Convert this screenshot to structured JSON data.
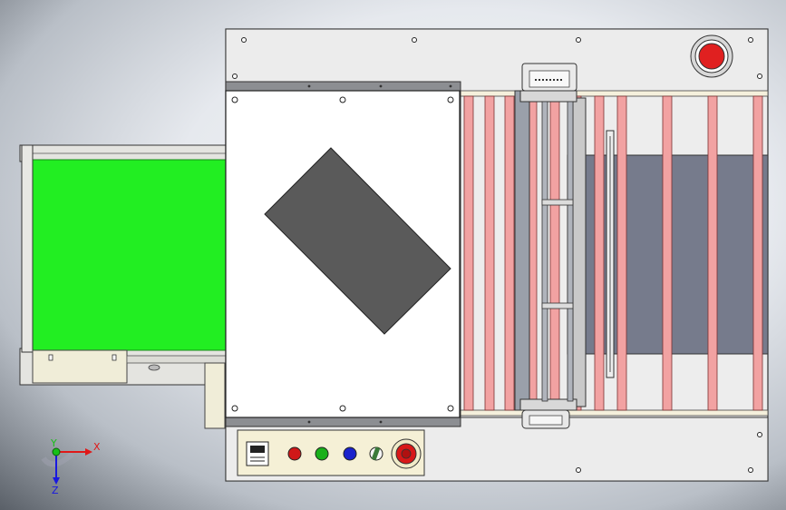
{
  "viewport": {
    "kind": "cad-3d-viewport",
    "background": "gradient-light-gray"
  },
  "model": {
    "description_parts": [
      "left-belt-conveyor",
      "shrink-tunnel-cover",
      "roller-conveyor",
      "sealing-frame",
      "control-panel",
      "emergency-stop"
    ],
    "colors": {
      "belt": "#22ee22",
      "frame": "#ededed",
      "cover": "#ffffff",
      "product": "#5a5a5a",
      "rollers": "#f2a2a2",
      "roller_bed": "#767b8c",
      "estop": "#e02020"
    },
    "control_panel": {
      "buttons": [
        {
          "name": "red-button",
          "color": "#d01818"
        },
        {
          "name": "green-button",
          "color": "#1ab01a"
        },
        {
          "name": "blue-button",
          "color": "#1a22cc"
        },
        {
          "name": "selector-switch",
          "color": "#4a8a4a"
        }
      ]
    }
  },
  "triad": {
    "x_label": "X",
    "y_label": "Y",
    "z_label": "Z",
    "x_color": "#e01818",
    "y_color": "#18c018",
    "z_color": "#1818e0"
  }
}
